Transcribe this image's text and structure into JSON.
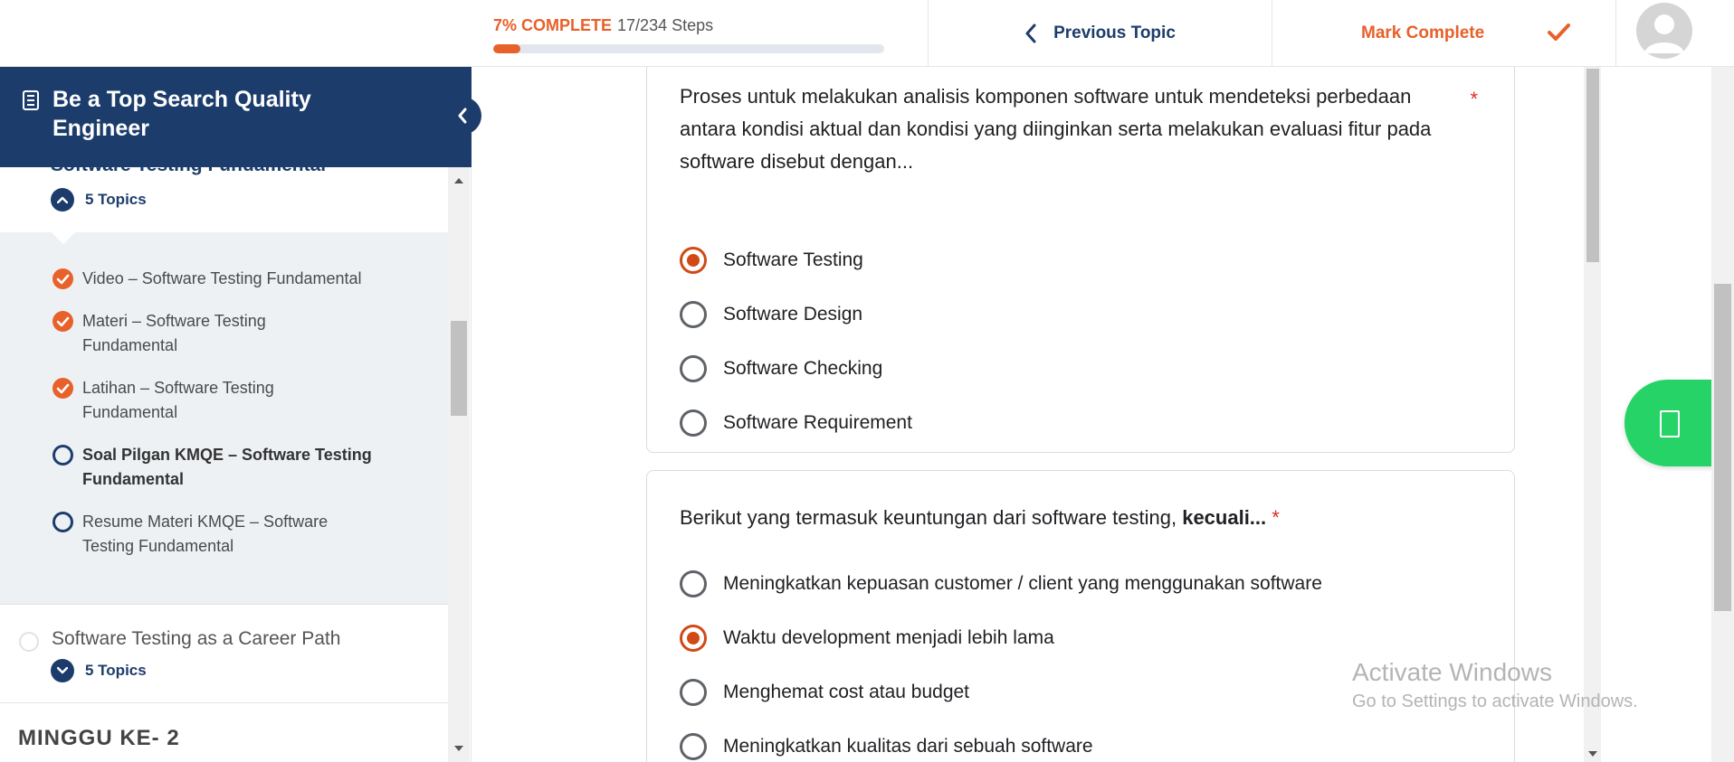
{
  "header": {
    "progress_percent_label": "7% COMPLETE",
    "progress_steps": "17/234 Steps",
    "progress_fraction": 0.07,
    "previous_topic_label": "Previous Topic",
    "mark_complete_label": "Mark Complete"
  },
  "sidebar": {
    "course_title": "Be a Top Search Quality Engineer",
    "current_lesson": "Software Testing Fundamental",
    "current_lesson_topics": "5 Topics",
    "topics": [
      {
        "label": "Video – Software Testing Fundamental",
        "status": "complete"
      },
      {
        "label": "Materi – Software Testing Fundamental",
        "status": "complete"
      },
      {
        "label": "Latihan – Software Testing Fundamental",
        "status": "complete"
      },
      {
        "label": "Soal Pilgan KMQE – Software Testing Fundamental",
        "status": "current"
      },
      {
        "label": "Resume Materi KMQE – Software Testing Fundamental",
        "status": "incomplete"
      }
    ],
    "next_lesson": "Software Testing as a Career Path",
    "next_lesson_topics": "5 Topics",
    "next_section_heading": "MINGGU KE- 2"
  },
  "quiz": {
    "question1": {
      "text": "Proses untuk melakukan analisis komponen software untuk mendeteksi perbedaan antara kondisi aktual dan kondisi yang diinginkan serta melakukan evaluasi fitur pada software disebut dengan...",
      "required_mark": "*",
      "options": [
        "Software Testing",
        "Software Design",
        "Software Checking",
        "Software Requirement"
      ],
      "selected": "Software Testing"
    },
    "question2": {
      "text": "Berikut yang termasuk keuntungan dari software testing, ",
      "text_bold": "kecuali...",
      "required_mark": "*",
      "options": [
        "Meningkatkan kepuasan customer / client yang menggunakan software",
        "Waktu development menjadi lebih lama",
        "Menghemat cost atau budget",
        "Meningkatkan kualitas dari sebuah software"
      ],
      "selected": "Waktu development menjadi lebih lama"
    }
  },
  "watermark": {
    "title": "Activate Windows",
    "subtitle": "Go to Settings to activate Windows."
  },
  "colors": {
    "accent_orange": "#e8602a",
    "navy": "#1c3d6b",
    "radio_selected": "#d14a16",
    "required_red": "#d93025",
    "fab_green": "#25d366"
  },
  "icons": [
    "book-icon",
    "chevron-left-icon",
    "checkmark-icon",
    "avatar-icon",
    "chevron-up-icon",
    "chevron-down-icon",
    "check-circle-icon",
    "whatsapp-icon"
  ]
}
